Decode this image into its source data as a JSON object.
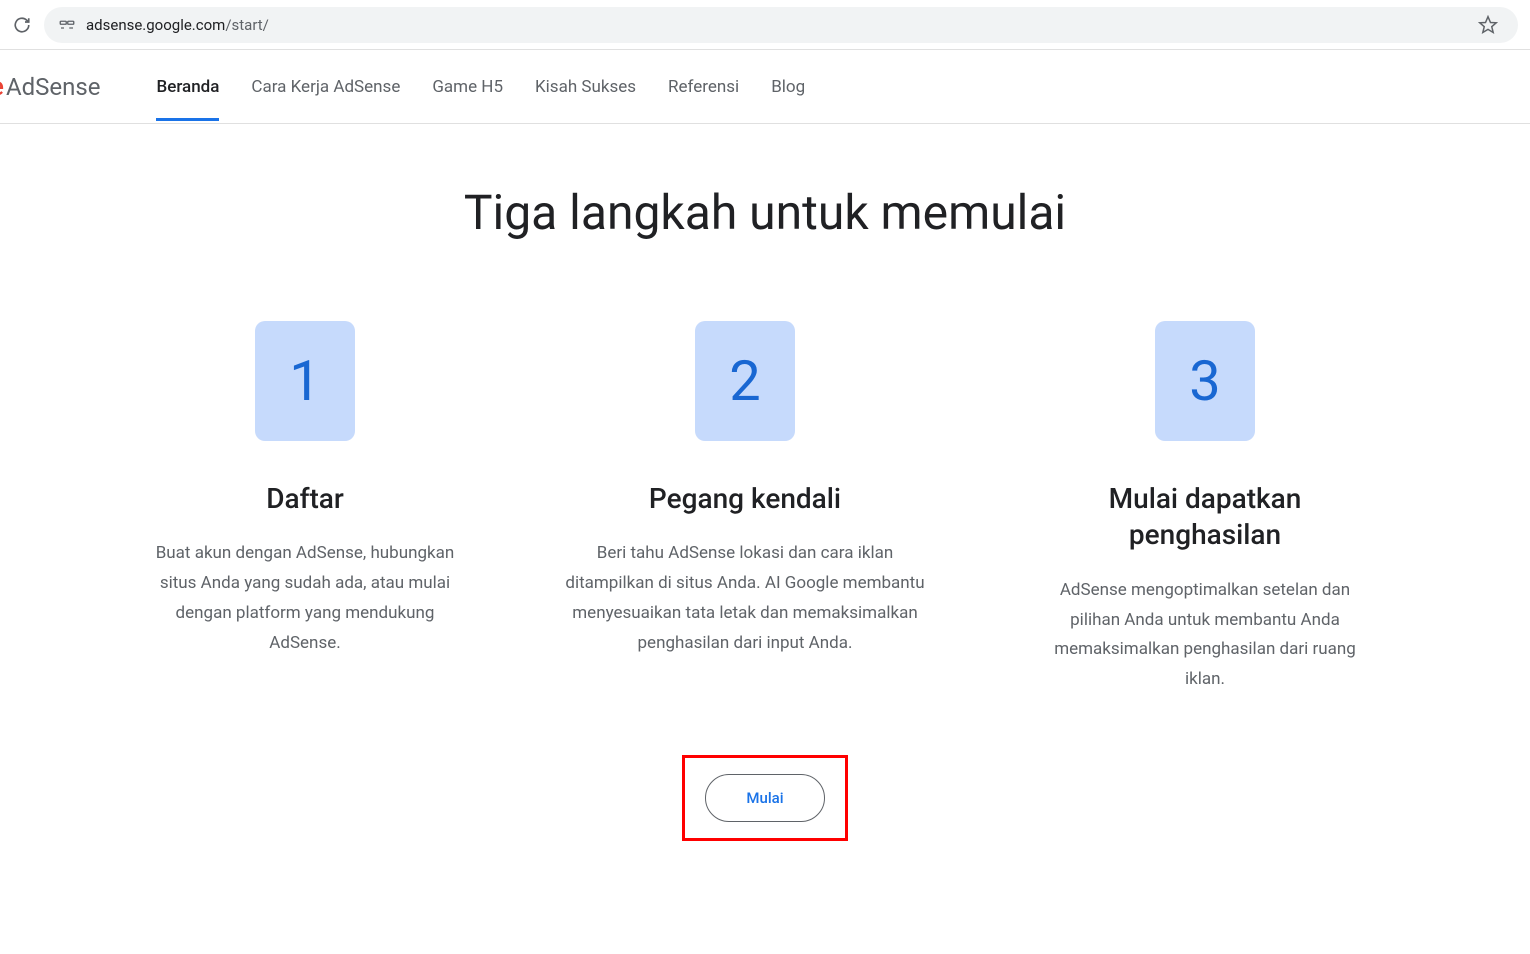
{
  "browser": {
    "url_host": "adsense.google.com",
    "url_path": "/start/"
  },
  "header": {
    "logo_fragment": "e",
    "product_name": "AdSense",
    "nav": [
      {
        "label": "Beranda",
        "active": true
      },
      {
        "label": "Cara Kerja AdSense",
        "active": false
      },
      {
        "label": "Game H5",
        "active": false
      },
      {
        "label": "Kisah Sukses",
        "active": false
      },
      {
        "label": "Referensi",
        "active": false
      },
      {
        "label": "Blog",
        "active": false
      }
    ]
  },
  "main": {
    "title": "Tiga langkah untuk memulai",
    "steps": [
      {
        "number": "1",
        "title": "Daftar",
        "desc": "Buat akun dengan AdSense, hubungkan situs Anda yang sudah ada, atau mulai dengan platform yang mendukung AdSense."
      },
      {
        "number": "2",
        "title": "Pegang kendali",
        "desc": "Beri tahu AdSense lokasi dan cara iklan ditampilkan di situs Anda. AI Google membantu menyesuaikan tata letak dan memaksimalkan penghasilan dari input Anda."
      },
      {
        "number": "3",
        "title": "Mulai dapatkan penghasilan",
        "desc": "AdSense mengoptimalkan setelan dan pilihan Anda untuk membantu Anda memaksimalkan penghasilan dari ruang iklan."
      }
    ],
    "cta_label": "Mulai"
  }
}
